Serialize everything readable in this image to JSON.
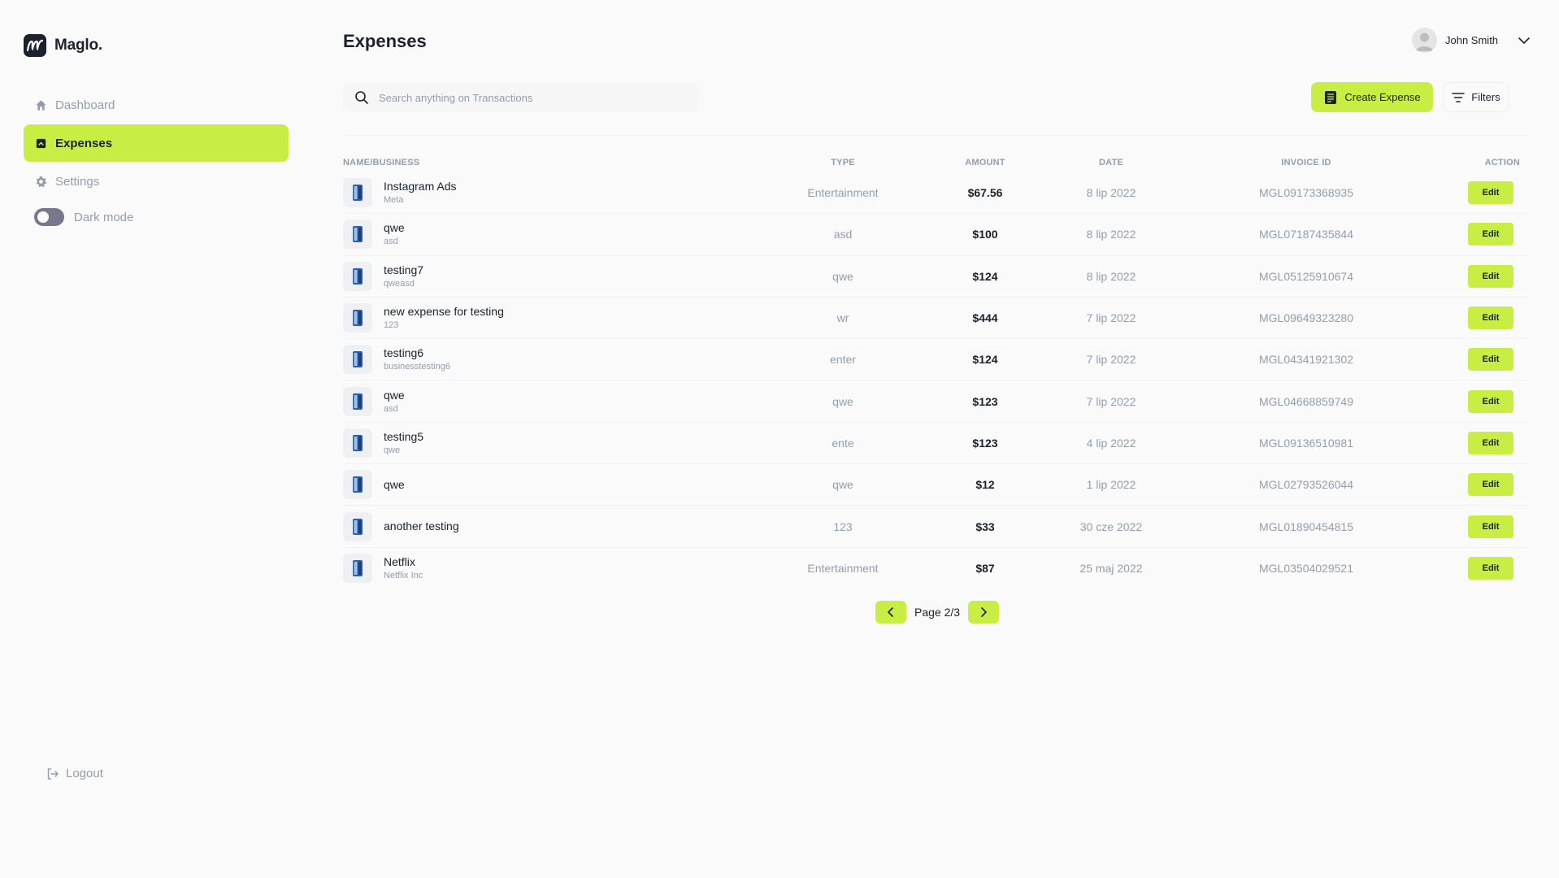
{
  "app": {
    "name": "Maglo."
  },
  "sidebar": {
    "items": [
      {
        "label": "Dashboard",
        "icon": "home-icon",
        "active": false
      },
      {
        "label": "Expenses",
        "icon": "expenses-icon",
        "active": true
      },
      {
        "label": "Settings",
        "icon": "gear-icon",
        "active": false
      }
    ],
    "dark_mode_label": "Dark mode",
    "logout_label": "Logout"
  },
  "header": {
    "title": "Expenses",
    "user_name": "John Smith"
  },
  "toolbar": {
    "search_placeholder": "Search anything on Transactions",
    "create_label": "Create Expense",
    "filters_label": "Filters"
  },
  "table": {
    "columns": [
      "NAME/BUSINESS",
      "TYPE",
      "AMOUNT",
      "DATE",
      "INVOICE ID",
      "ACTION"
    ],
    "rows": [
      {
        "name": "Instagram Ads",
        "business": "Meta",
        "type": "Entertainment",
        "amount": "$67.56",
        "date": "8 lip 2022",
        "invoice": "MGL09173368935",
        "action": "Edit"
      },
      {
        "name": "qwe",
        "business": "asd",
        "type": "asd",
        "amount": "$100",
        "date": "8 lip 2022",
        "invoice": "MGL07187435844",
        "action": "Edit"
      },
      {
        "name": "testing7",
        "business": "qweasd",
        "type": "qwe",
        "amount": "$124",
        "date": "8 lip 2022",
        "invoice": "MGL05125910674",
        "action": "Edit"
      },
      {
        "name": "new expense for testing",
        "business": "123",
        "type": "wr",
        "amount": "$444",
        "date": "7 lip 2022",
        "invoice": "MGL09649323280",
        "action": "Edit"
      },
      {
        "name": "testing6",
        "business": "businesstesting6",
        "type": "enter",
        "amount": "$124",
        "date": "7 lip 2022",
        "invoice": "MGL04341921302",
        "action": "Edit"
      },
      {
        "name": "qwe",
        "business": "asd",
        "type": "qwe",
        "amount": "$123",
        "date": "7 lip 2022",
        "invoice": "MGL04668859749",
        "action": "Edit"
      },
      {
        "name": "testing5",
        "business": "qwe",
        "type": "ente",
        "amount": "$123",
        "date": "4 lip 2022",
        "invoice": "MGL09136510981",
        "action": "Edit"
      },
      {
        "name": "qwe",
        "business": "",
        "type": "qwe",
        "amount": "$12",
        "date": "1 lip 2022",
        "invoice": "MGL02793526044",
        "action": "Edit"
      },
      {
        "name": "another testing",
        "business": "",
        "type": "123",
        "amount": "$33",
        "date": "30 cze 2022",
        "invoice": "MGL01890454815",
        "action": "Edit"
      },
      {
        "name": "Netflix",
        "business": "Netflix Inc",
        "type": "Entertainment",
        "amount": "$87",
        "date": "25 maj 2022",
        "invoice": "MGL03504029521",
        "action": "Edit"
      }
    ]
  },
  "pagination": {
    "label": "Page 2/3"
  },
  "colors": {
    "accent": "#c8ee44",
    "text": "#1b212d",
    "muted": "#929eae",
    "background": "#fafafa"
  }
}
